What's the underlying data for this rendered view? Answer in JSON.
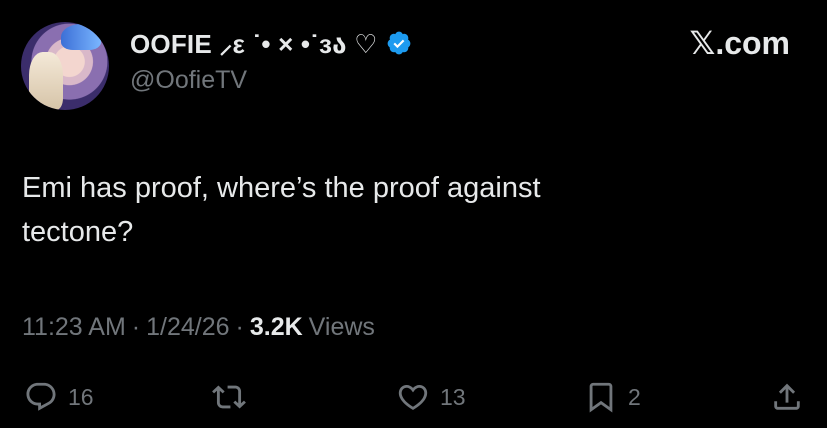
{
  "author": {
    "display_name": "OOFIE ⸝ε ˙• × •˙зა ♡",
    "handle": "@OofieTV",
    "verified": true,
    "avatar_icon": "avatar-image"
  },
  "brand": {
    "logo_text": "𝕏.com"
  },
  "tweet": {
    "text_line1": "Emi has proof, where’s the proof against",
    "text_line2": "tectone?"
  },
  "meta": {
    "time": "11:23 AM",
    "sep1": "·",
    "date": "1/24/26",
    "sep2": "·",
    "views_count": "3.2K",
    "views_label": "Views"
  },
  "actions": {
    "reply_count": "16",
    "repost_count": "",
    "like_count": "13",
    "bookmark_count": "2"
  },
  "colors": {
    "background": "#000000",
    "text": "#e7e9ea",
    "secondary": "#71767b",
    "verified": "#1d9bf0"
  }
}
